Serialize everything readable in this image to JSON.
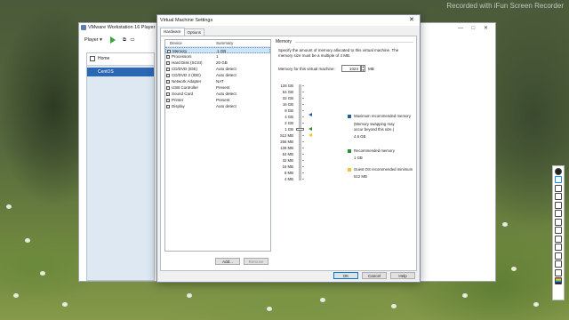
{
  "watermark": "Recorded with iFun Screen Recorder",
  "player": {
    "title": "VMware Workstation 16 Player (No",
    "menu_label": "Player",
    "home_label": "Home",
    "vm_name": "CentOS"
  },
  "dialog": {
    "title": "Virtual Machine Settings",
    "close_symbol": "✕",
    "tabs": [
      "Hardware",
      "Options"
    ],
    "device_header": {
      "device": "Device",
      "summary": "Summary"
    },
    "devices": [
      {
        "name": "Memory",
        "summary": "1 GB",
        "selected": true,
        "icon": "memory-icon"
      },
      {
        "name": "Processors",
        "summary": "1",
        "icon": "processor-icon"
      },
      {
        "name": "Hard Disk (SCSI)",
        "summary": "20 GB",
        "icon": "hard-disk-icon"
      },
      {
        "name": "CD/DVD (IDE)",
        "summary": "Auto detect",
        "icon": "cd-dvd-icon"
      },
      {
        "name": "CD/DVD 2 (IDE)",
        "summary": "Auto detect",
        "icon": "cd-dvd-icon"
      },
      {
        "name": "Network Adapter",
        "summary": "NAT",
        "icon": "network-icon"
      },
      {
        "name": "USB Controller",
        "summary": "Present",
        "icon": "usb-icon"
      },
      {
        "name": "Sound Card",
        "summary": "Auto detect",
        "icon": "sound-icon"
      },
      {
        "name": "Printer",
        "summary": "Present",
        "icon": "printer-icon"
      },
      {
        "name": "Display",
        "summary": "Auto detect",
        "icon": "display-icon"
      }
    ],
    "add_button": "Add...",
    "remove_button": "Remove",
    "memory": {
      "group_title": "Memory",
      "description": "Specify the amount of memory allocated to this virtual machine. The memory size must be a multiple of 4 MB.",
      "field_label": "Memory for this virtual machine:",
      "value": "1024",
      "unit": "MB",
      "scale": [
        "128 GB",
        "64 GB",
        "32 GB",
        "16 GB",
        "8 GB",
        "4 GB",
        "2 GB",
        "1 GB",
        "512 MB",
        "256 MB",
        "128 MB",
        "64 MB",
        "32 MB",
        "16 MB",
        "8 MB",
        "4 MB"
      ],
      "legend": {
        "max_title": "Maximum recommended memory",
        "max_note": "(Memory swapping may occur beyond this size.)",
        "max_value": "4.6 GB",
        "rec_title": "Recommended memory",
        "rec_value": "1 GB",
        "min_title": "Guest OS recommended minimum",
        "min_value": "512 MB"
      },
      "colors": {
        "max": "#1f5fa6",
        "rec": "#2e8b2e",
        "min": "#f2c12e"
      }
    },
    "ok_button": "OK",
    "cancel_button": "Cancel",
    "help_button": "Help"
  }
}
